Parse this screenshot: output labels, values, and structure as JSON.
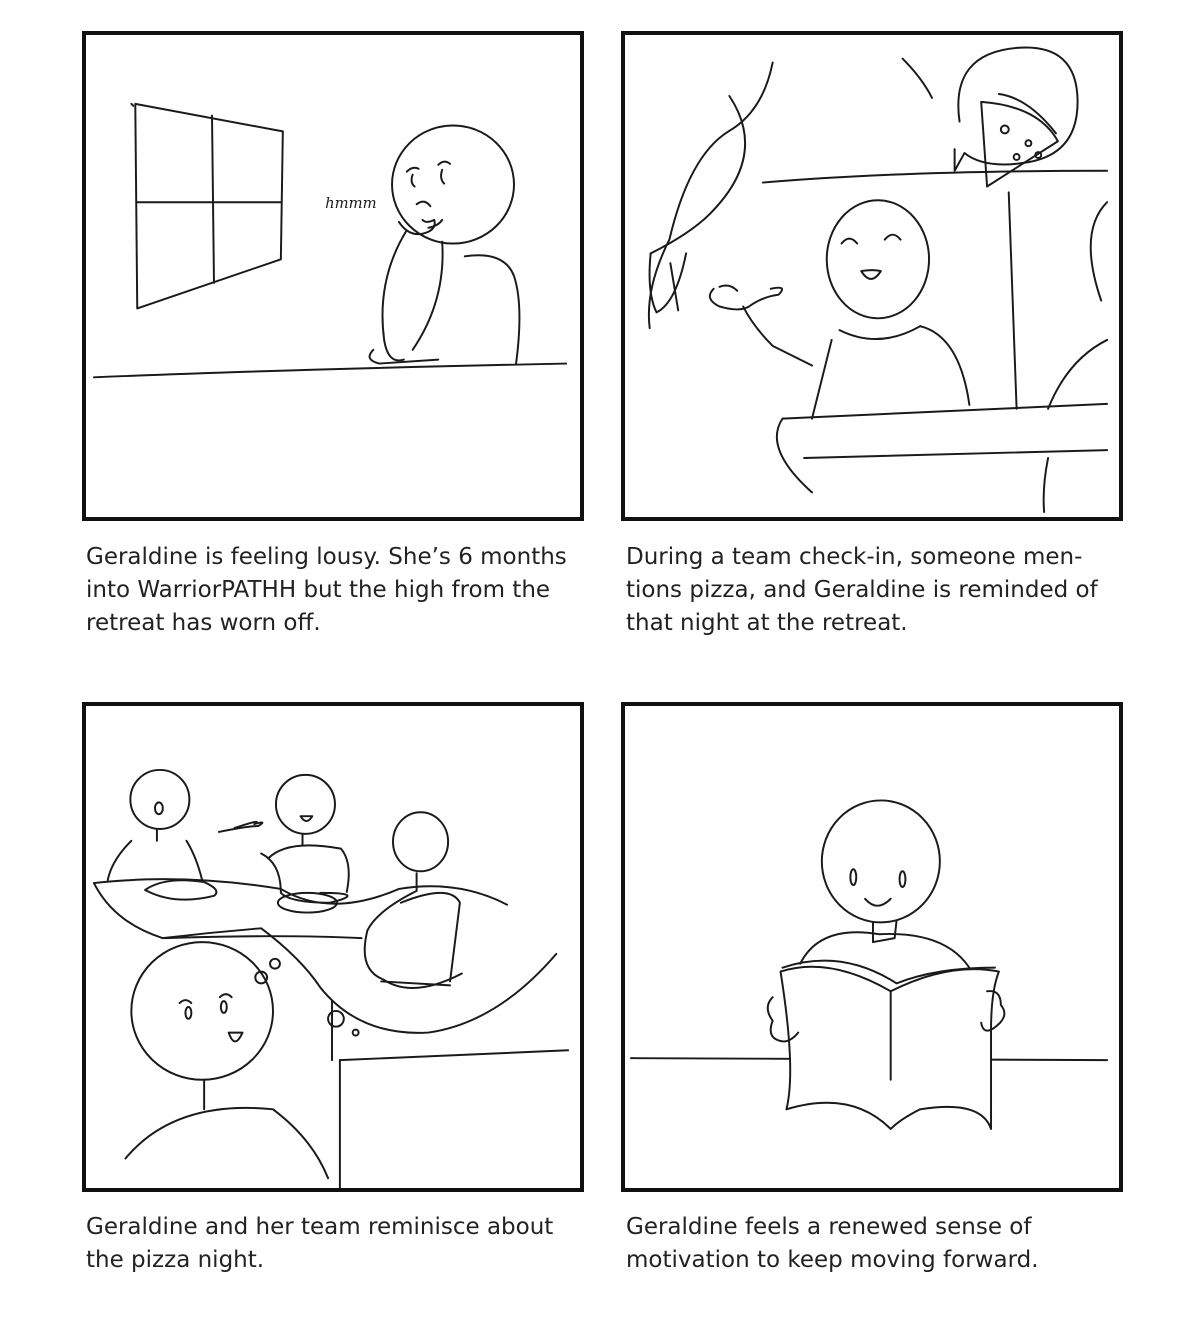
{
  "panels": [
    {
      "id": "panel-1",
      "caption": "Geraldine is feeling lousy. She’s 6 months into WarriorPATHH but the high from the retreat has worn off.",
      "sound_effect": "hmmm"
    },
    {
      "id": "panel-2",
      "caption": "During a team check-in, someone men-tions pizza, and Geraldine is reminded of that night at the retreat."
    },
    {
      "id": "panel-3",
      "caption": "Geraldine and her team reminisce about the pizza night."
    },
    {
      "id": "panel-4",
      "caption": "Geraldine feels a renewed sense of motivation to keep moving forward."
    }
  ],
  "icons": [
    "thinking-figure",
    "window",
    "pizza-slice-thought-bubble",
    "laughing-figure",
    "dinner-table-memory",
    "thought-bubble",
    "reading-figure",
    "open-book"
  ]
}
